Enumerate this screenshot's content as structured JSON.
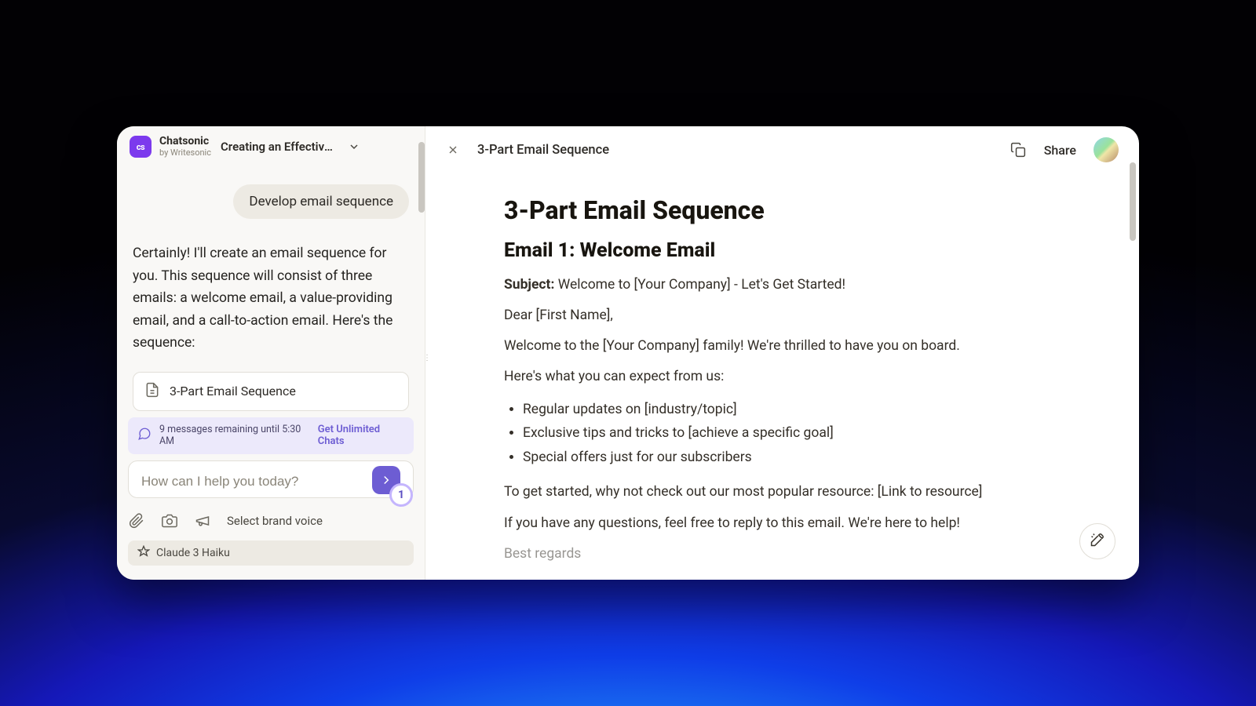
{
  "app": {
    "name": "Chatsonic",
    "byline": "by Writesonic",
    "logo_text": "cs"
  },
  "thread": {
    "title": "Creating an Effective Email S"
  },
  "conversation": {
    "user_prompt": "Develop email sequence",
    "assistant_reply": "Certainly! I'll create an email sequence for you. This sequence will consist of three emails: a welcome email, a value-providing email, and a call-to-action email. Here's the sequence:",
    "generated_doc_title": "3-Part Email Sequence"
  },
  "quota": {
    "remaining_text": "9 messages remaining until 5:30 AM",
    "cta": "Get Unlimited Chats"
  },
  "composer": {
    "placeholder": "How can I help you today?",
    "badge_count": "1",
    "brand_voice_label": "Select brand voice",
    "model_label": "Claude 3 Haiku"
  },
  "doc_header": {
    "title": "3-Part Email Sequence",
    "share_label": "Share"
  },
  "document": {
    "h1": "3-Part Email Sequence",
    "email1_heading": "Email 1: Welcome Email",
    "subject_label": "Subject:",
    "subject_value": "Welcome to [Your Company] - Let's Get Started!",
    "greeting": "Dear [First Name],",
    "intro": "Welcome to the [Your Company] family! We're thrilled to have you on board.",
    "expect_line": "Here's what you can expect from us:",
    "bullets": {
      "b1": "Regular updates on [industry/topic]",
      "b2": "Exclusive tips and tricks to [achieve a specific goal]",
      "b3": "Special offers just for our subscribers"
    },
    "cta_line": "To get started, why not check out our most popular resource: [Link to resource]",
    "help_line": "If you have any questions, feel free to reply to this email. We're here to help!",
    "signoff": "Best regards"
  }
}
